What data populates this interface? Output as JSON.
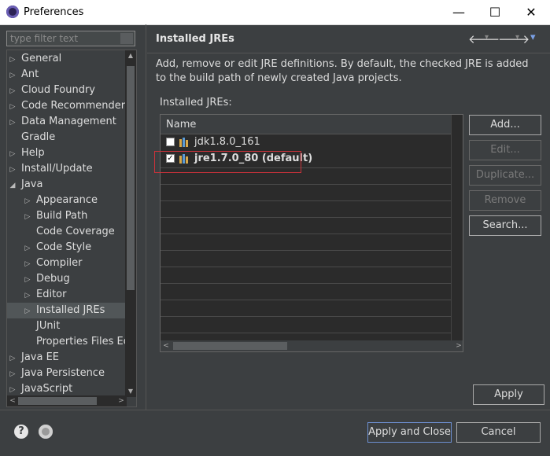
{
  "window": {
    "title": "Preferences",
    "minimize_label": "—",
    "maximize_label": "☐",
    "close_label": "✕"
  },
  "filter": {
    "placeholder": "type filter text"
  },
  "tree": {
    "items": [
      {
        "label": "General",
        "arrow": "▷",
        "indent": 0
      },
      {
        "label": "Ant",
        "arrow": "▷",
        "indent": 0
      },
      {
        "label": "Cloud Foundry",
        "arrow": "▷",
        "indent": 0
      },
      {
        "label": "Code Recommenders",
        "arrow": "▷",
        "indent": 0
      },
      {
        "label": "Data Management",
        "arrow": "▷",
        "indent": 0
      },
      {
        "label": "Gradle",
        "arrow": "",
        "indent": 0
      },
      {
        "label": "Help",
        "arrow": "▷",
        "indent": 0
      },
      {
        "label": "Install/Update",
        "arrow": "▷",
        "indent": 0
      },
      {
        "label": "Java",
        "arrow": "◢",
        "indent": 0
      },
      {
        "label": "Appearance",
        "arrow": "▷",
        "indent": 1
      },
      {
        "label": "Build Path",
        "arrow": "▷",
        "indent": 1
      },
      {
        "label": "Code Coverage",
        "arrow": "",
        "indent": 1
      },
      {
        "label": "Code Style",
        "arrow": "▷",
        "indent": 1
      },
      {
        "label": "Compiler",
        "arrow": "▷",
        "indent": 1
      },
      {
        "label": "Debug",
        "arrow": "▷",
        "indent": 1
      },
      {
        "label": "Editor",
        "arrow": "▷",
        "indent": 1
      },
      {
        "label": "Installed JREs",
        "arrow": "▷",
        "indent": 1,
        "selected": true
      },
      {
        "label": "JUnit",
        "arrow": "",
        "indent": 1
      },
      {
        "label": "Properties Files Ed",
        "arrow": "",
        "indent": 1
      },
      {
        "label": "Java EE",
        "arrow": "▷",
        "indent": 0
      },
      {
        "label": "Java Persistence",
        "arrow": "▷",
        "indent": 0
      },
      {
        "label": "JavaScript",
        "arrow": "▷",
        "indent": 0
      }
    ]
  },
  "pane": {
    "title": "Installed JREs",
    "back_icon": "🡐",
    "forward_icon": "🡒",
    "menu_icon": "▾",
    "dropdown_icon": "▾",
    "description": "Add, remove or edit JRE definitions. By default, the checked JRE is added to the build path of newly created Java projects.",
    "jres_label": "Installed JREs:",
    "table_header": "Name",
    "jres": [
      {
        "name": "jdk1.8.0_161",
        "checked": false,
        "default": false
      },
      {
        "name": "jre1.7.0_80 (default)",
        "checked": true,
        "default": true
      }
    ],
    "buttons": {
      "add": "Add...",
      "edit": "Edit...",
      "duplicate": "Duplicate...",
      "remove": "Remove",
      "search": "Search...",
      "apply": "Apply"
    }
  },
  "footer": {
    "help_glyph": "?",
    "apply_close": "Apply and Close",
    "cancel": "Cancel"
  },
  "colors": {
    "background": "#3c3f41",
    "highlight_border": "#c8323a",
    "primary_border": "#6d8fd1"
  }
}
